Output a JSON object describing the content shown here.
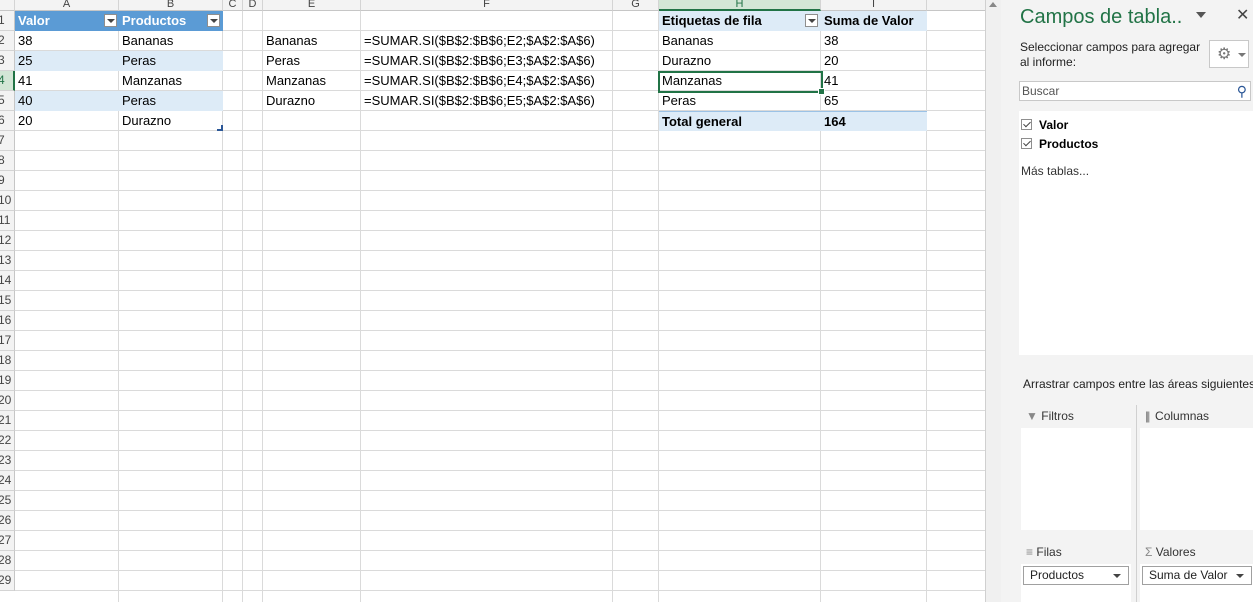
{
  "columns": [
    "A",
    "B",
    "C",
    "D",
    "E",
    "F",
    "G",
    "H",
    "I"
  ],
  "row_numbers": [
    "1",
    "2",
    "3",
    "4",
    "5",
    "6",
    "7",
    "8",
    "9",
    "10",
    "11",
    "12",
    "13",
    "14",
    "15",
    "16",
    "17",
    "18",
    "19",
    "20",
    "21",
    "22",
    "23",
    "24",
    "25",
    "26",
    "27",
    "28",
    "29"
  ],
  "table": {
    "headers": [
      "Valor",
      "Productos"
    ],
    "rows": [
      [
        "38",
        "Bananas"
      ],
      [
        "25",
        "Peras"
      ],
      [
        "41",
        "Manzanas"
      ],
      [
        "40",
        "Peras"
      ],
      [
        "20",
        "Durazno"
      ]
    ]
  },
  "formulas": {
    "labels": [
      "Bananas",
      "Peras",
      "Manzanas",
      "Durazno"
    ],
    "formulas": [
      "=SUMAR.SI($B$2:$B$6;E2;$A$2:$A$6)",
      "=SUMAR.SI($B$2:$B$6;E3;$A$2:$A$6)",
      "=SUMAR.SI($B$2:$B$6;E4;$A$2:$A$6)",
      "=SUMAR.SI($B$2:$B$6;E5;$A$2:$A$6)"
    ]
  },
  "pivot": {
    "header_labels": "Etiquetas de fila",
    "header_values": "Suma de Valor",
    "rows": [
      [
        "Bananas",
        "38"
      ],
      [
        "Durazno",
        "20"
      ],
      [
        "Manzanas",
        "41"
      ],
      [
        "Peras",
        "65"
      ]
    ],
    "total_label": "Total general",
    "total_value": "164"
  },
  "active_cell": "H4",
  "panel": {
    "title": "Campos de tabla..",
    "close_label": "✕",
    "subtitle": "Seleccionar campos para agregar al informe:",
    "search_placeholder": "Buscar",
    "fields": [
      {
        "label": "Valor",
        "checked": true
      },
      {
        "label": "Productos",
        "checked": true
      }
    ],
    "more_tables": "Más tablas...",
    "areas_hint": "Arrastrar campos entre las áreas siguientes:",
    "areas": {
      "filters": "Filtros",
      "columns": "Columnas",
      "rows": "Filas",
      "values": "Valores"
    },
    "rows_item": "Productos",
    "values_item": "Suma de Valor"
  },
  "colors": {
    "table_header": "#5b9bd5",
    "table_band": "#ddebf7",
    "selection": "#217346",
    "panel_title": "#217346"
  },
  "icons": {
    "filter": "filter-icon",
    "columns": "columns-icon",
    "rows": "rows-icon",
    "values": "sigma-icon",
    "settings": "gear-icon",
    "search": "search-icon"
  }
}
